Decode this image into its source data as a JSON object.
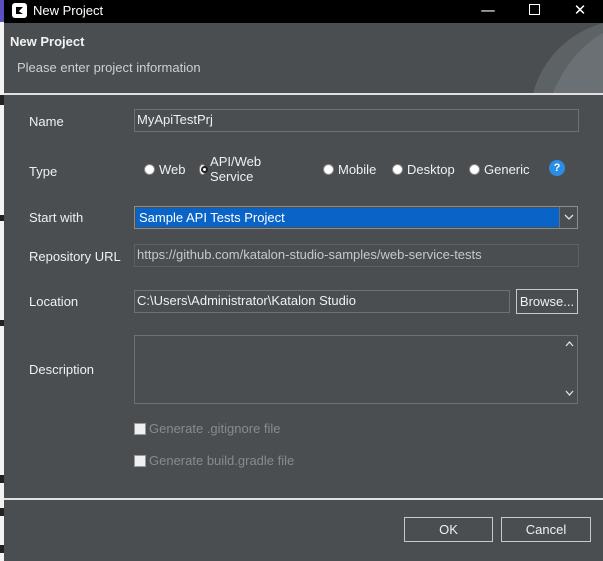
{
  "window": {
    "title": "New Project",
    "controls": {
      "minimize": "—",
      "close": "✕"
    }
  },
  "header": {
    "title": "New Project",
    "subtitle": "Please enter project information"
  },
  "form": {
    "name": {
      "label": "Name",
      "value": "MyApiTestPrj"
    },
    "type": {
      "label": "Type",
      "options": [
        "Web",
        "API/Web Service",
        "Mobile",
        "Desktop",
        "Generic"
      ],
      "selected": "API/Web Service",
      "help_glyph": "?"
    },
    "start_with": {
      "label": "Start with",
      "value": "Sample API Tests Project"
    },
    "repository_url": {
      "label": "Repository URL",
      "value": "https://github.com/katalon-studio-samples/web-service-tests"
    },
    "location": {
      "label": "Location",
      "value": "C:\\Users\\Administrator\\Katalon Studio",
      "browse_label": "Browse..."
    },
    "description": {
      "label": "Description",
      "value": ""
    },
    "gitignore": {
      "label": "Generate .gitignore file",
      "checked": false,
      "enabled": false
    },
    "build_gradle": {
      "label": "Generate build.gradle file",
      "checked": false,
      "enabled": false
    }
  },
  "footer": {
    "ok_label": "OK",
    "cancel_label": "Cancel"
  },
  "colors": {
    "dialog_bg": "#4a4e50",
    "titlebar_bg": "#000000",
    "selection": "#0a64c8",
    "help_icon": "#2a8ee6"
  }
}
